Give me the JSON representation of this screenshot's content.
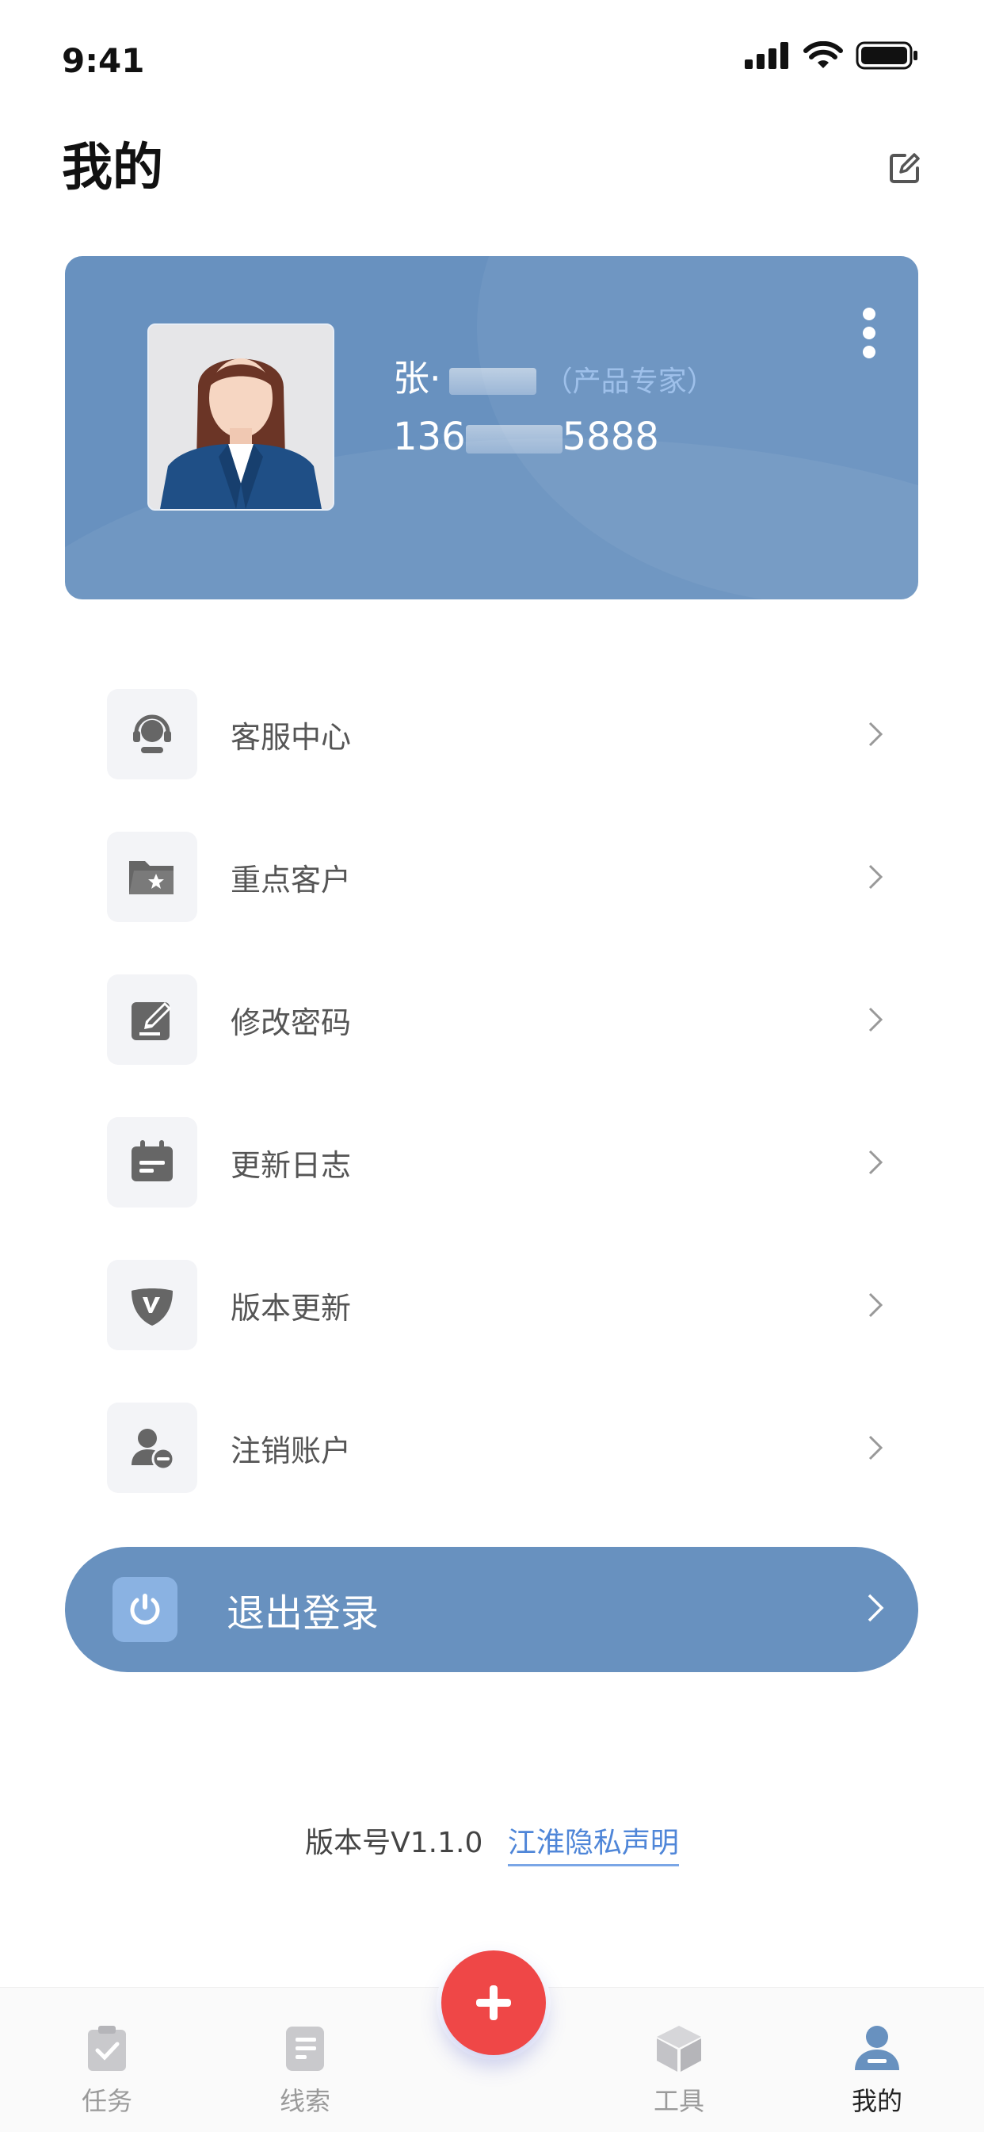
{
  "status_bar": {
    "time": "9:41"
  },
  "header": {
    "title": "我的",
    "edit_icon": "edit-icon"
  },
  "profile": {
    "name_prefix": "张·",
    "role": "（产品专家）",
    "phone_prefix": "136",
    "phone_suffix": "5888",
    "colors": {
      "card_bg": "#6891bf",
      "role_text": "#9ec0ea"
    }
  },
  "menu": {
    "items": [
      {
        "label": "客服中心",
        "icon": "headset-icon"
      },
      {
        "label": "重点客户",
        "icon": "star-folder-icon"
      },
      {
        "label": "修改密码",
        "icon": "edit-password-icon"
      },
      {
        "label": "更新日志",
        "icon": "calendar-icon"
      },
      {
        "label": "版本更新",
        "icon": "version-icon"
      },
      {
        "label": "注销账户",
        "icon": "remove-user-icon"
      }
    ]
  },
  "logout": {
    "label": "退出登录",
    "icon": "power-icon"
  },
  "footer": {
    "version": "版本号V1.1.0",
    "privacy_link": "江淮隐私声明"
  },
  "tabbar": {
    "tabs": [
      {
        "label": "任务",
        "icon": "clipboard-icon",
        "active": false
      },
      {
        "label": "线索",
        "icon": "document-icon",
        "active": false
      },
      {
        "label": "工具",
        "icon": "box-icon",
        "active": false
      },
      {
        "label": "我的",
        "icon": "user-icon",
        "active": true
      }
    ],
    "fab_icon": "plus-icon"
  },
  "colors": {
    "accent": "#6891bf",
    "fab": "#ef4747",
    "link": "#4f86d8"
  }
}
